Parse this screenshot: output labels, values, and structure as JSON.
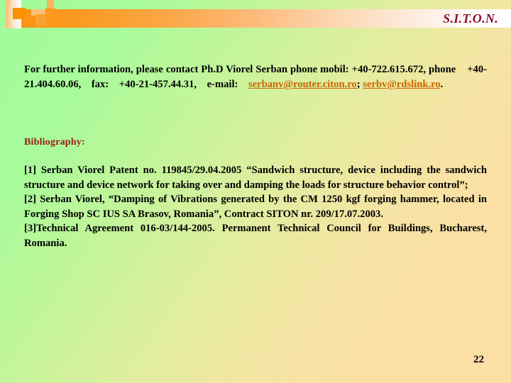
{
  "slide": {
    "logo": "S.I.T.O.N.",
    "page_number": "22",
    "colors": {
      "background_start": "#a2fb9b",
      "background_end": "#fcdfa5",
      "header_band_start": "#fb9412",
      "header_band_end": "#ffffff",
      "logo_color": "#8d0b33",
      "heading_color": "#9b1b16",
      "link_color": "#cc6600",
      "body_text_color": "#000000"
    }
  },
  "contact": {
    "line_prefix": "For further information, please contact Ph.D Viorel Serban phone mobil: +40-722.615.672, phone    +40-21.404.60.06,    fax:    +40-21-457.44.31,    e-mail:",
    "segment_1": "For further information, please contact Ph.D Viorel Serban phone mobil: +40-722.615.672, phone",
    "phone_fixed": "+40-21.404.60.06,",
    "fax_label": "fax:",
    "fax_number": "+40-21-457.44.31,",
    "email_label": "e-mail:",
    "email_1": "serbanv@router.citon.ro",
    "email_1_suffix": ";",
    "email_2": "serbv@rdslink.ro",
    "email_2_suffix": "."
  },
  "bibliography": {
    "heading": "Bibliography:",
    "entries": [
      "[1] Serban Viorel Patent no. 119845/29.04.2005 “Sandwich structure, device including the sandwich structure and device network for taking over and damping the loads for structure behavior control”;",
      "[2] Serban Viorel, “Damping of Vibrations generated by the CM 1250 kgf forging hammer, located in Forging Shop SC IUS SA Brasov, Romania”, Contract SITON nr. 209/17.07.2003.",
      "[3]Technical Agreement 016-03/144-2005. Permanent Technical Council for Buildings, Bucharest, Romania."
    ]
  }
}
